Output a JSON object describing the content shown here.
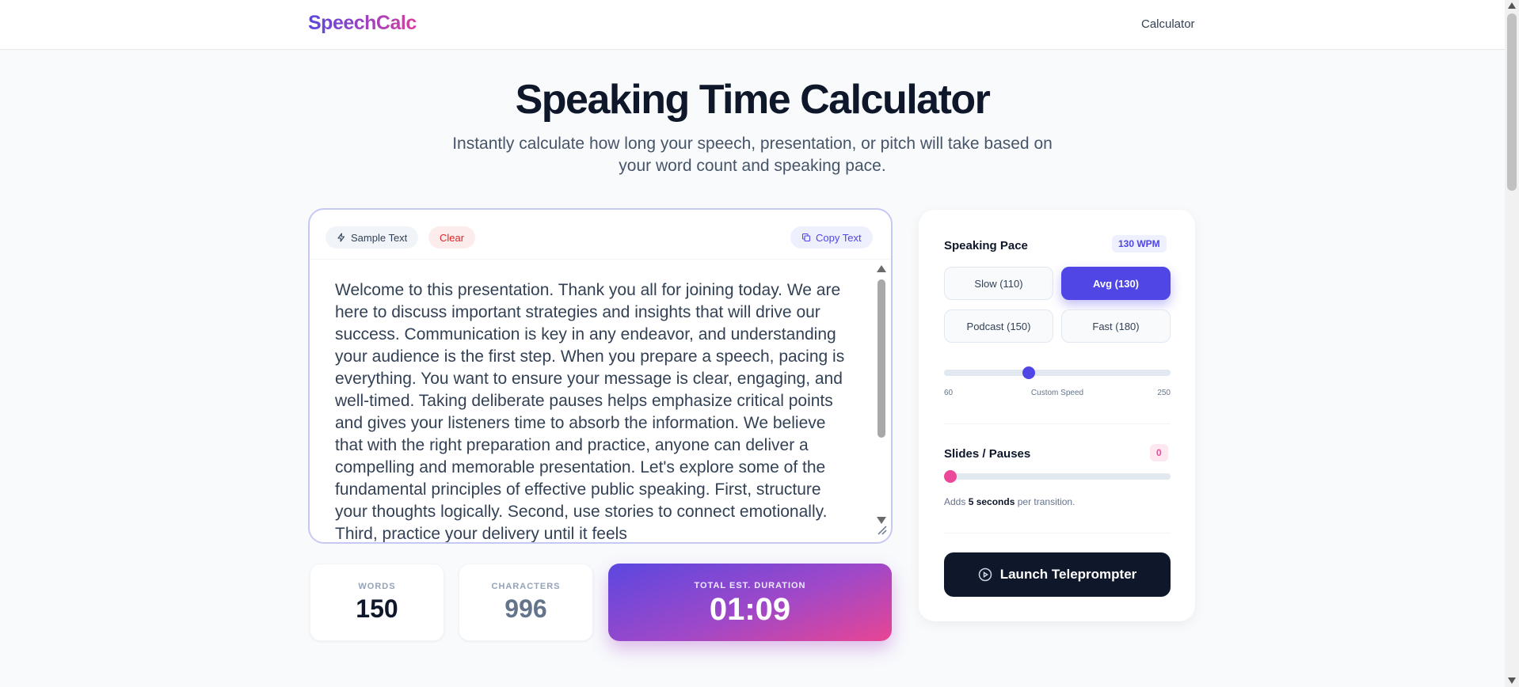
{
  "header": {
    "logo": "SpeechCalc",
    "nav_link": "Calculator"
  },
  "hero": {
    "title": "Speaking Time Calculator",
    "subtitle": "Instantly calculate how long your speech, presentation, or pitch will take based on your word count and speaking pace."
  },
  "editor": {
    "sample_button": "Sample Text",
    "clear_button": "Clear",
    "copy_button": "Copy Text",
    "text": "Welcome to this presentation. Thank you all for joining today. We are here to discuss important strategies and insights that will drive our success. Communication is key in any endeavor, and understanding your audience is the first step. When you prepare a speech, pacing is everything. You want to ensure your message is clear, engaging, and well-timed. Taking deliberate pauses helps emphasize critical points and gives your listeners time to absorb the information. We believe that with the right preparation and practice, anyone can deliver a compelling and memorable presentation. Let's explore some of the fundamental principles of effective public speaking. First, structure your thoughts logically. Second, use stories to connect emotionally. Third, practice your delivery until it feels"
  },
  "stats": {
    "words_label": "WORDS",
    "words_value": "150",
    "chars_label": "CHARACTERS",
    "chars_value": "996",
    "duration_label": "TOTAL EST. DURATION",
    "duration_value": "01:09"
  },
  "pace": {
    "title": "Speaking Pace",
    "badge": "130 WPM",
    "buttons": [
      {
        "label": "Slow (110)",
        "active": false
      },
      {
        "label": "Avg (130)",
        "active": true
      },
      {
        "label": "Podcast (150)",
        "active": false
      },
      {
        "label": "Fast (180)",
        "active": false
      }
    ],
    "slider_min_label": "60",
    "slider_caption": "Custom Speed",
    "slider_max_label": "250",
    "slider_min": 60,
    "slider_max": 250,
    "slider_value": 130,
    "accent_color": "#4f46e5"
  },
  "slides": {
    "title": "Slides / Pauses",
    "badge": "0",
    "value": 0,
    "note_prefix": "Adds ",
    "note_bold": "5 seconds",
    "note_suffix": " per transition.",
    "accent_color": "#ec4899"
  },
  "teleprompter": {
    "button": "Launch Teleprompter"
  }
}
